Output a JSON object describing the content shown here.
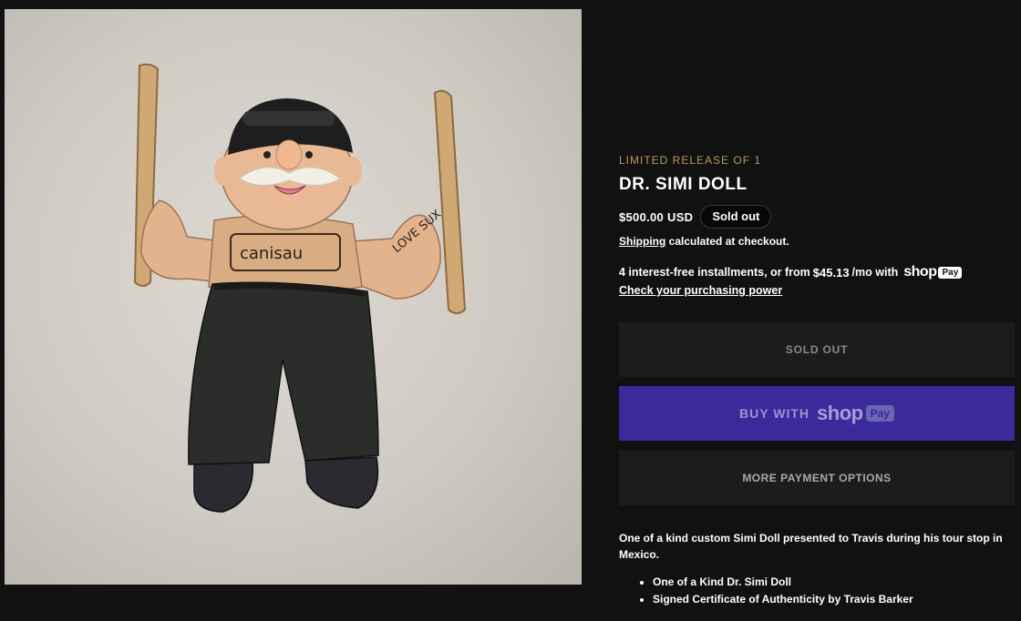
{
  "product": {
    "vendor": "LIMITED RELEASE OF 1",
    "title": "DR. SIMI DOLL",
    "price": "$500.00 USD",
    "badge": "Sold out",
    "shipping_link": "Shipping",
    "shipping_rest": " calculated at checkout.",
    "installments_prefix": "4 interest-free installments, or from",
    "installments_amount": "$45.13",
    "installments_suffix": "/mo with",
    "shop_logo": "shop",
    "shop_pay_chip": "Pay",
    "check_power": "Check your purchasing power",
    "sold_out_button": "SOLD OUT",
    "buy_with": "BUY WITH",
    "shop_button_logo": "shop",
    "shop_button_pay": "Pay",
    "more_payment": "MORE PAYMENT OPTIONS",
    "description": "One of a kind custom Simi Doll presented to Travis during his tour stop in Mexico.",
    "bullets": [
      "One of a Kind Dr. Simi Doll",
      "Signed Certificate of Authenticity by Travis Barker"
    ]
  },
  "colors": {
    "background": "#111111",
    "vendor_gold": "#b99a5f",
    "shop_pay_purple": "#3a2a9a",
    "button_dark": "#1c1c1c"
  },
  "image": {
    "doll_text_shirt": "canisau",
    "doll_text_arm": "LOVE SUX"
  }
}
